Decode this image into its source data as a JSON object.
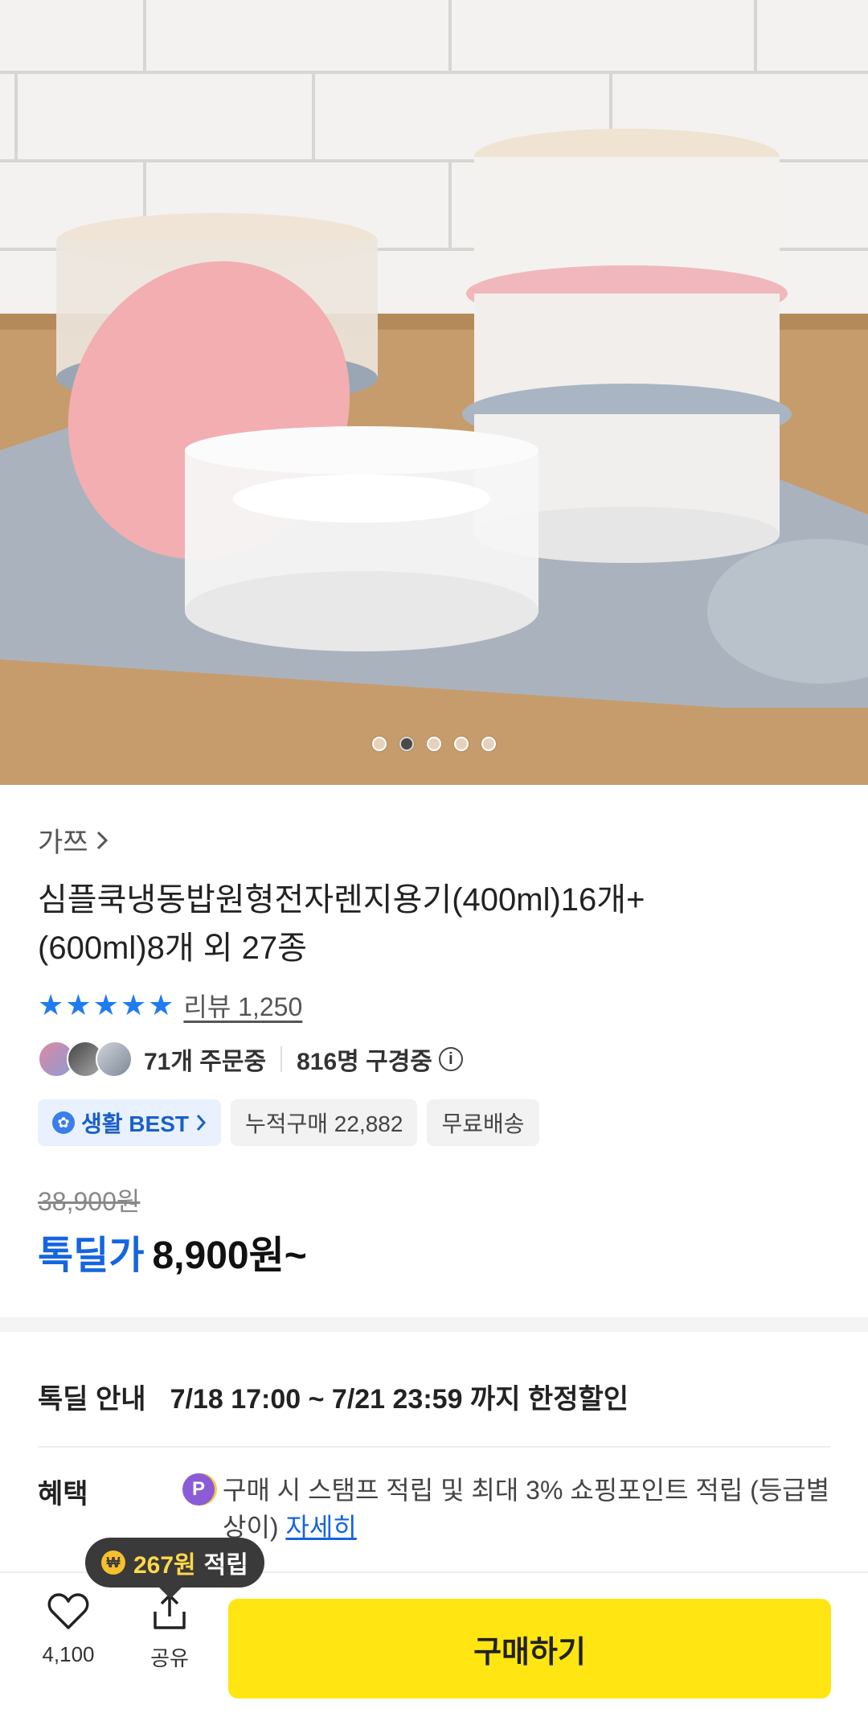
{
  "hero": {
    "image_alt": "product-photo",
    "carousel": {
      "count": 5,
      "active_index": 1
    }
  },
  "product": {
    "brand": "가쯔",
    "title_line1": "심플쿡냉동밥원형전자렌지용기(400ml)16개+",
    "title_line2": "(600ml)8개 외 27종",
    "rating": 5,
    "review_label": "리뷰 1,250",
    "orders_text": "71개 주문중",
    "viewers_text": "816명 구경중",
    "chips": {
      "best": "생활 BEST",
      "cumulative": "누적구매 22,882",
      "shipping": "무료배송"
    },
    "original_price": "38,900원",
    "deal_label": "톡딜가",
    "deal_price": "8,900원~"
  },
  "deal_info": {
    "label": "톡딜 안내",
    "period": "7/18 17:00 ~ 7/21 23:59 까지 한정할인"
  },
  "benefit": {
    "label": "혜택",
    "text": "구매 시 스탬프 적립 및 최대 3% 쇼핑포인트 적립 (등급별 상이)",
    "link": "자세히"
  },
  "bottom_bar": {
    "like_count": "4,100",
    "share_label": "공유",
    "buy_label": "구매하기",
    "tooltip_amount": "267원",
    "tooltip_suffix": "적립"
  },
  "colors": {
    "accent_blue": "#1565e0",
    "buy_yellow": "#ffe612",
    "star_blue": "#1f7cf0"
  }
}
